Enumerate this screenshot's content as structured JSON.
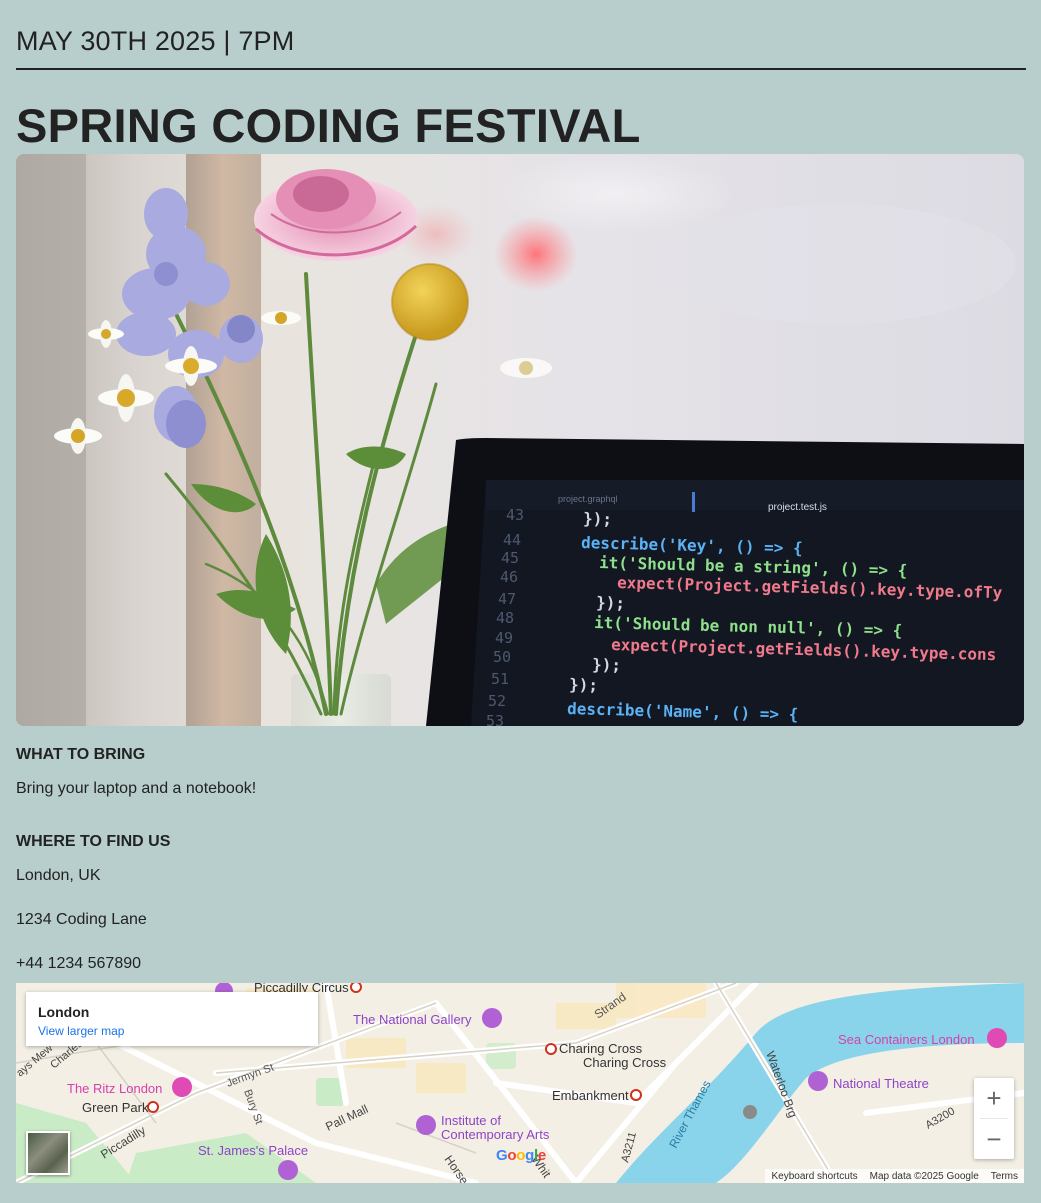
{
  "event": {
    "date_line": "MAY 30TH 2025 | 7PM",
    "title": "SPRING CODING FESTIVAL"
  },
  "hero": {
    "code_tabs": [
      "project.graphql",
      "project.test.js"
    ],
    "line_numbers": [
      "43",
      "44",
      "45",
      "46",
      "47",
      "48",
      "49",
      "50",
      "51",
      "52",
      "53"
    ],
    "code_lines": [
      "});",
      "describe('Key', () => {",
      "it('Should be a string', () => {",
      "expect(Project.getFields().key.type.ofTy",
      "});",
      "it('Should be non null', () => {",
      "expect(Project.getFields().key.type.cons",
      "});",
      "});",
      "describe('Name', () => {"
    ]
  },
  "bring": {
    "heading": "WHAT TO BRING",
    "text": "Bring your laptop and a notebook!"
  },
  "location": {
    "heading": "WHERE TO FIND US",
    "city": "London, UK",
    "address": "1234 Coding Lane",
    "phone": "+44 1234 567890"
  },
  "map": {
    "place_name": "London",
    "larger_map_link": "View larger map",
    "zoom_in": "+",
    "zoom_out": "−",
    "footer": {
      "shortcuts": "Keyboard shortcuts",
      "map_data": "Map data ©2025 Google",
      "terms": "Terms"
    },
    "logo": "Google",
    "labels": {
      "piccadilly_circus": "Piccadilly Circus",
      "national_gallery": "The National Gallery",
      "strand": "Strand",
      "charing_cross_1": "Charing Cross",
      "charing_cross_2": "Charing Cross",
      "sea_containers": "Sea Containers London",
      "ritz": "The Ritz London",
      "jermyn_st": "Jermyn St",
      "green_park": "Green Park",
      "bury_st": "Bury St",
      "piccadilly": "Piccadilly",
      "pall_mall": "Pall Mall",
      "embankment": "Embankment",
      "ica": "Institute of",
      "ica2": "Contemporary Arts",
      "national_theatre": "National Theatre",
      "waterloo_brg": "Waterloo Brg",
      "river_thames": "River Thames",
      "a3211": "A3211",
      "a3200": "A3200",
      "st_james": "St. James's Palace",
      "horse": "Horse",
      "whit": "Whit",
      "charles": "Charles",
      "ays_mew": "ays Mew"
    },
    "colors": {
      "water": "#8ad4eb",
      "park": "#c8ebc9",
      "poi_purple": "#8e44c7",
      "poi_pink": "#d63fae",
      "link_blue": "#1a73e8"
    }
  },
  "colors": {
    "page_bg": "#b8cecd",
    "text": "#222222"
  }
}
